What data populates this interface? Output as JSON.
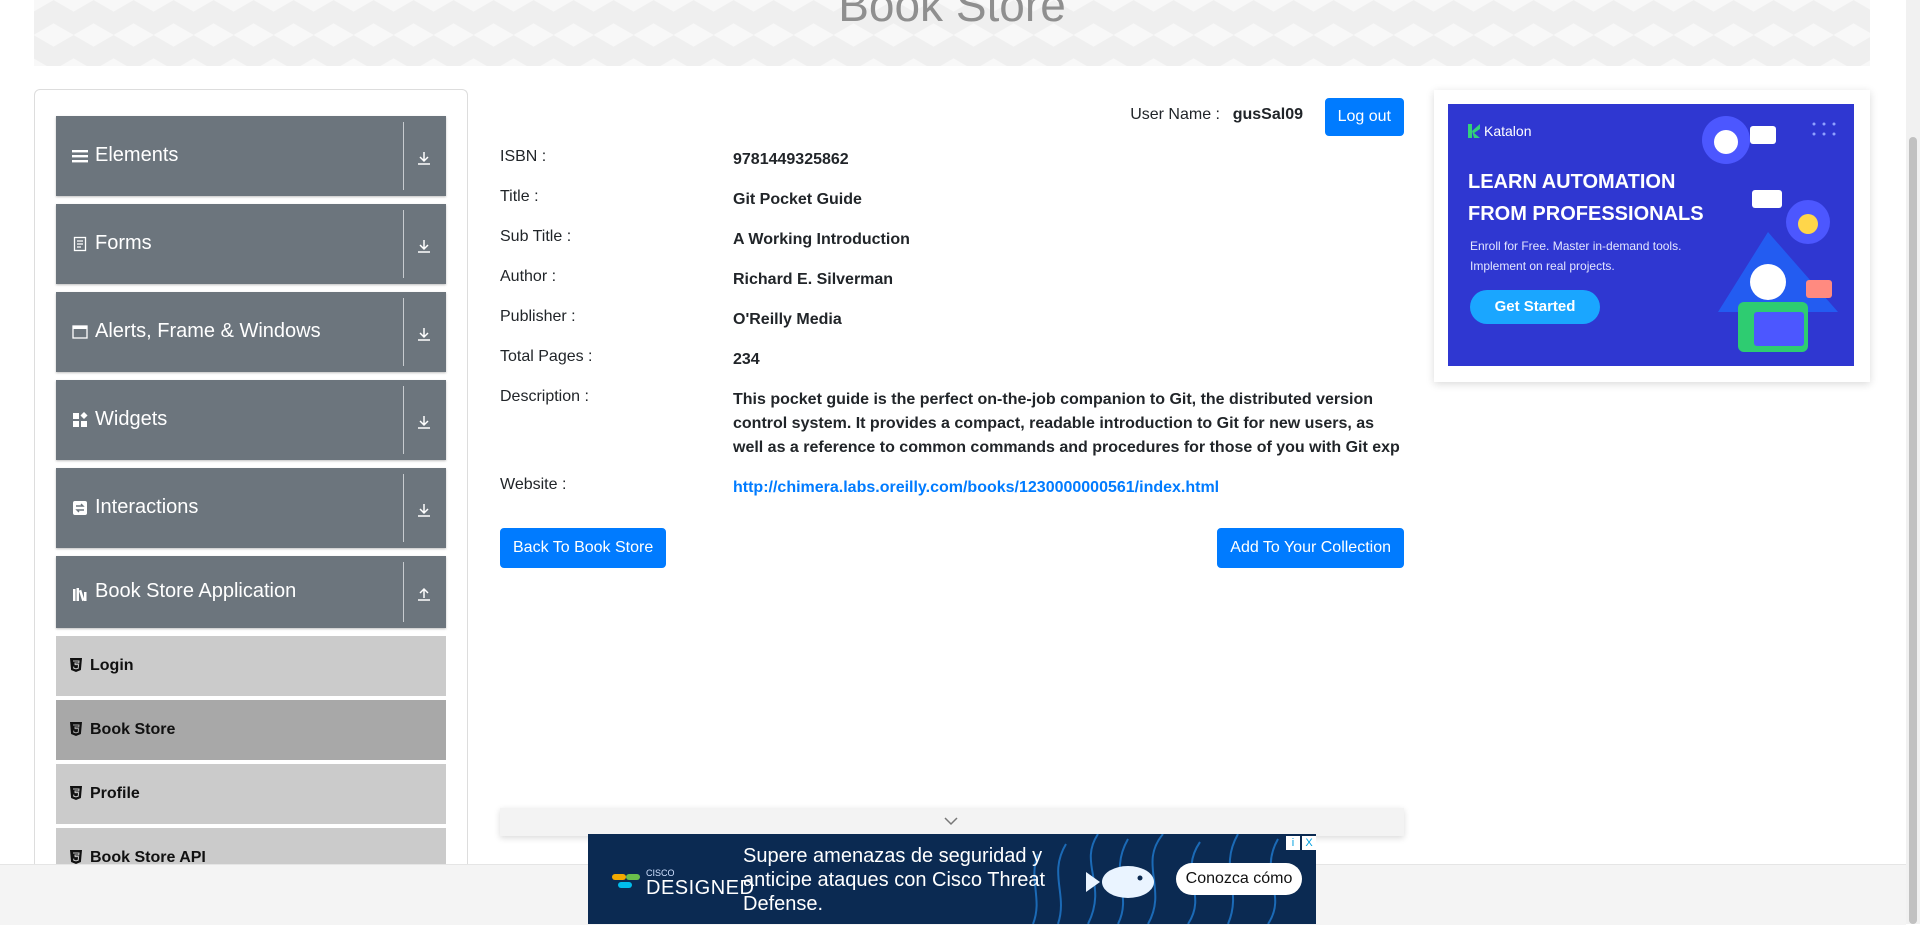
{
  "header": {
    "title": "Book Store"
  },
  "sidebar": {
    "groups": [
      {
        "label": "Elements",
        "icon": "list-icon",
        "expanded": false
      },
      {
        "label": "Forms",
        "icon": "form-icon",
        "expanded": false
      },
      {
        "label": "Alerts, Frame & Windows",
        "icon": "window-icon",
        "expanded": false
      },
      {
        "label": "Widgets",
        "icon": "widgets-icon",
        "expanded": false
      },
      {
        "label": "Interactions",
        "icon": "interactions-icon",
        "expanded": false
      },
      {
        "label": "Book Store Application",
        "icon": "books-icon",
        "expanded": true
      }
    ],
    "subitems": [
      {
        "label": "Login",
        "active": false
      },
      {
        "label": "Book Store",
        "active": true
      },
      {
        "label": "Profile",
        "active": false
      },
      {
        "label": "Book Store API",
        "active": false
      }
    ]
  },
  "user": {
    "label": "User Name :",
    "value": "gusSal09",
    "logout": "Log out"
  },
  "book": {
    "isbn_label": "ISBN :",
    "isbn": "9781449325862",
    "title_label": "Title :",
    "title": "Git Pocket Guide",
    "subtitle_label": "Sub Title :",
    "subtitle": "A Working Introduction",
    "author_label": "Author :",
    "author": "Richard E. Silverman",
    "publisher_label": "Publisher :",
    "publisher": "O'Reilly Media",
    "pages_label": "Total Pages :",
    "pages": "234",
    "description_label": "Description :",
    "description": "This pocket guide is the perfect on-the-job companion to Git, the distributed version control system. It provides a compact, readable introduction to Git for new users, as well as a reference to common commands and procedures for those of you with Git exp",
    "website_label": "Website :",
    "website": "http://chimera.labs.oreilly.com/books/1230000000561/index.html"
  },
  "actions": {
    "back": "Back To Book Store",
    "add": "Add To Your Collection"
  },
  "ad_right": {
    "brand": "Katalon",
    "headline": "LEARN AUTOMATION FROM PROFESSIONALS",
    "subtext": "Enroll for Free. Master in-demand tools. Implement on real projects.",
    "cta": "Get Started"
  },
  "ad_bottom": {
    "brand_small": "CISCO",
    "brand_big": "DESIGNED",
    "text": "Supere amenazas de seguridad y anticipe ataques con Cisco Threat Defense.",
    "cta": "Conozca cómo",
    "info": "i",
    "close": "X"
  },
  "colors": {
    "accent": "#007bff",
    "sidebar_group": "#6c757d",
    "sidebar_sub": "#cbcbcb",
    "sidebar_sub_active": "#a8a8a8"
  }
}
